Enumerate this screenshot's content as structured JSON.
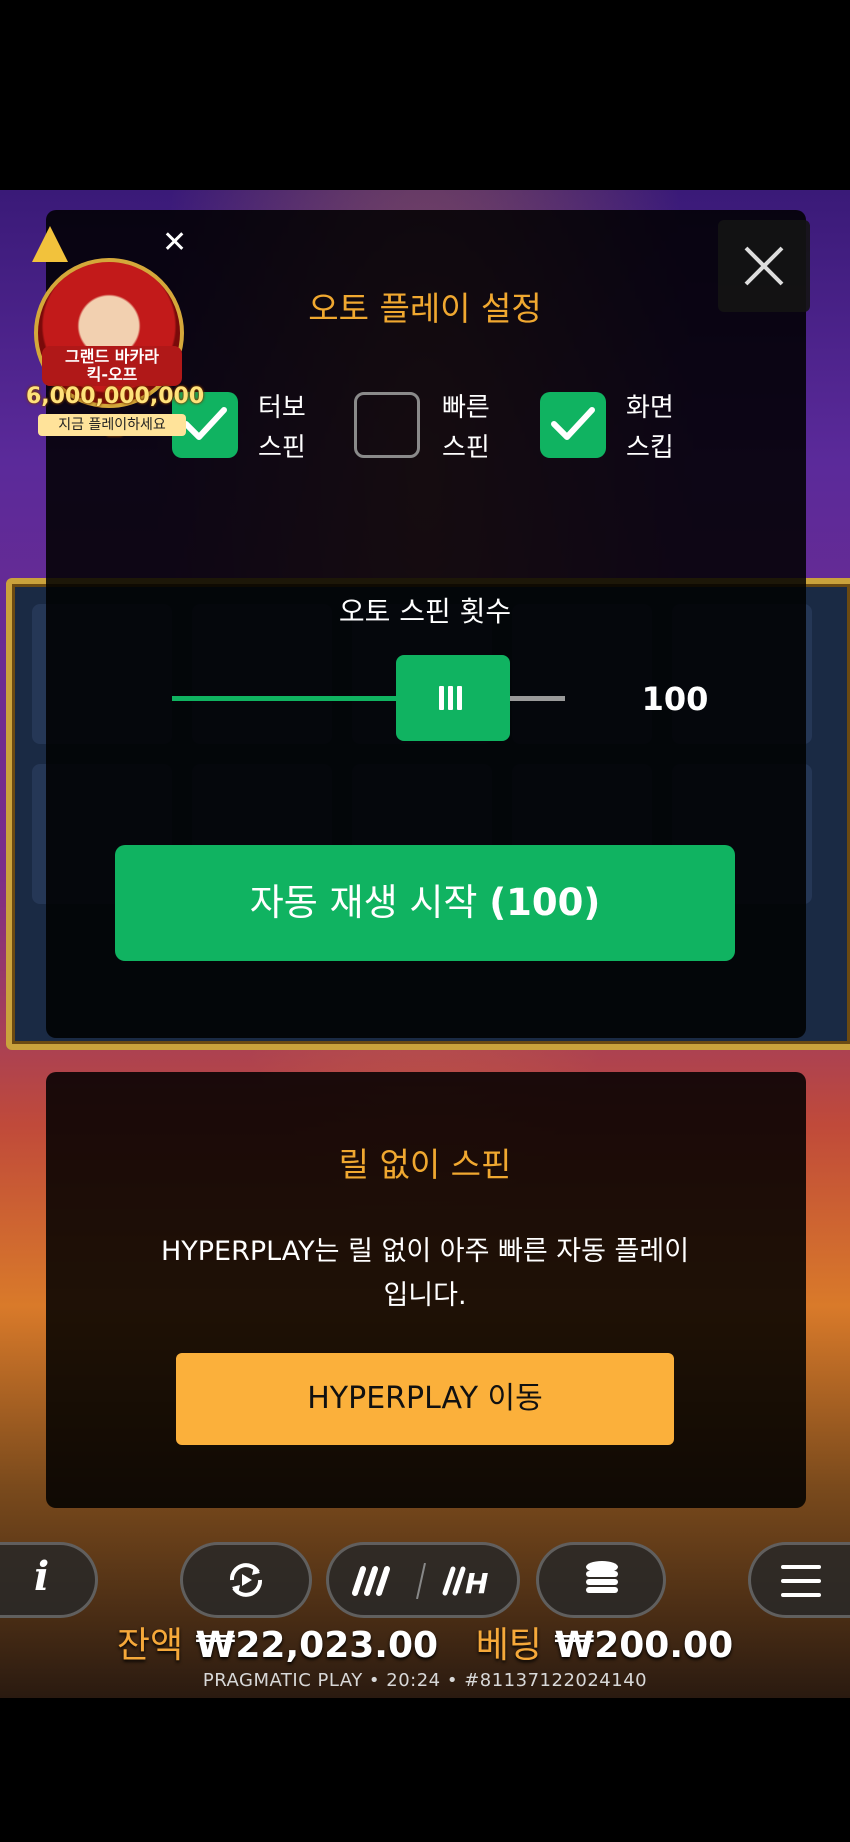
{
  "promo": {
    "close_symbol": "✕",
    "title_line1": "그랜드 바카라",
    "title_line2": "킥-오프",
    "amount": "6,000,000,000원",
    "cta": "지금 플레이하세요"
  },
  "autoplay": {
    "title": "오토 플레이 설정",
    "options": [
      {
        "line1": "터보",
        "line2": "스핀",
        "checked": true
      },
      {
        "line1": "빠른",
        "line2": "스핀",
        "checked": false
      },
      {
        "line1": "화면",
        "line2": "스킵",
        "checked": true
      }
    ],
    "spin_count_label": "오토 스핀 횟수",
    "spin_count_value": "100",
    "slider_level": 100,
    "start_button": "자동 재생 시작 ",
    "start_button_count": "(100)"
  },
  "hyperplay": {
    "title": "릴 없이 스핀",
    "description": "HYPERPLAY는 릴 없이 아주 빠른 자동 플레이입니다.",
    "button": "HYPERPLAY 이동"
  },
  "status": {
    "balance_label": "잔액",
    "balance_value": "₩22,023.00",
    "bet_label": "베팅",
    "bet_value": "₩200.00",
    "footer": "PRAGMATIC PLAY • 20:24 • #81137122024140"
  },
  "colors": {
    "accent_green": "#10b361",
    "title_gold": "#f0a830",
    "hyperplay_button": "#fbb03b"
  },
  "icons": [
    "close-icon",
    "checkmark-icon",
    "slider-grip-icon",
    "info-icon",
    "autoplay-icon",
    "turbo-icon",
    "coins-icon",
    "menu-icon"
  ]
}
